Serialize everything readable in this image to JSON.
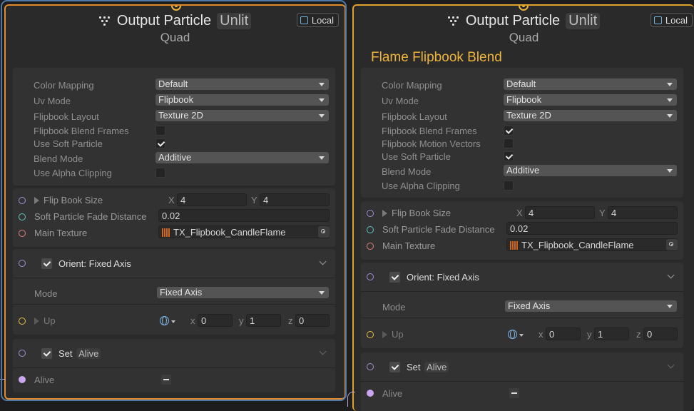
{
  "colors": {
    "selection": "#e38a2b",
    "port": "#f0b53a",
    "context_title": "#f0b53a"
  },
  "node1": {
    "title": "Output Particle",
    "mode": "Unlit",
    "subtitle": "Quad",
    "space_label": "Local",
    "props": [
      {
        "label": "Color Mapping",
        "value": "Default"
      },
      {
        "label": "Uv Mode",
        "value": "Flipbook"
      },
      {
        "label": "Flipbook Layout",
        "value": "Texture 2D"
      },
      {
        "label": "Flipbook Blend Frames",
        "checked": false
      },
      {
        "label": "Use Soft Particle",
        "checked": true
      },
      {
        "label": "Blend Mode",
        "value": "Additive"
      },
      {
        "label": "Use Alpha Clipping",
        "checked": false
      }
    ],
    "flipbook_size": {
      "label": "Flip Book Size",
      "x_label": "X",
      "x": "4",
      "y_label": "Y",
      "y": "4"
    },
    "soft_fade": {
      "label": "Soft Particle Fade Distance",
      "value": "0.02"
    },
    "main_texture": {
      "label": "Main Texture",
      "value": "TX_Flipbook_CandleFlame"
    },
    "orient": {
      "title": "Orient: Fixed Axis",
      "mode_label": "Mode",
      "mode_value": "Fixed Axis",
      "up_label": "Up",
      "x_label": "x",
      "x": "0",
      "y_label": "y",
      "y": "1",
      "z_label": "z",
      "z": "0"
    },
    "set": {
      "label": "Set",
      "value": "Alive",
      "prop_label": "Alive"
    }
  },
  "node2": {
    "title": "Output Particle",
    "mode": "Unlit",
    "subtitle": "Quad",
    "space_label": "Local",
    "context_title": "Flame Flipbook Blend",
    "props": [
      {
        "label": "Color Mapping",
        "value": "Default"
      },
      {
        "label": "Uv Mode",
        "value": "Flipbook"
      },
      {
        "label": "Flipbook Layout",
        "value": "Texture 2D"
      },
      {
        "label": "Flipbook Blend Frames",
        "checked": true
      },
      {
        "label": "Flipbook Motion Vectors",
        "checked": false
      },
      {
        "label": "Use Soft Particle",
        "checked": true
      },
      {
        "label": "Blend Mode",
        "value": "Additive"
      },
      {
        "label": "Use Alpha Clipping",
        "checked": false
      }
    ],
    "flipbook_size": {
      "label": "Flip Book Size",
      "x_label": "X",
      "x": "4",
      "y_label": "Y",
      "y": "4"
    },
    "soft_fade": {
      "label": "Soft Particle Fade Distance",
      "value": "0.02"
    },
    "main_texture": {
      "label": "Main Texture",
      "value": "TX_Flipbook_CandleFlame"
    },
    "orient": {
      "title": "Orient: Fixed Axis",
      "mode_label": "Mode",
      "mode_value": "Fixed Axis",
      "up_label": "Up",
      "x_label": "x",
      "x": "0",
      "y_label": "y",
      "y": "1",
      "z_label": "z",
      "z": "0"
    },
    "set": {
      "label": "Set",
      "value": "Alive",
      "prop_label": "Alive"
    }
  }
}
